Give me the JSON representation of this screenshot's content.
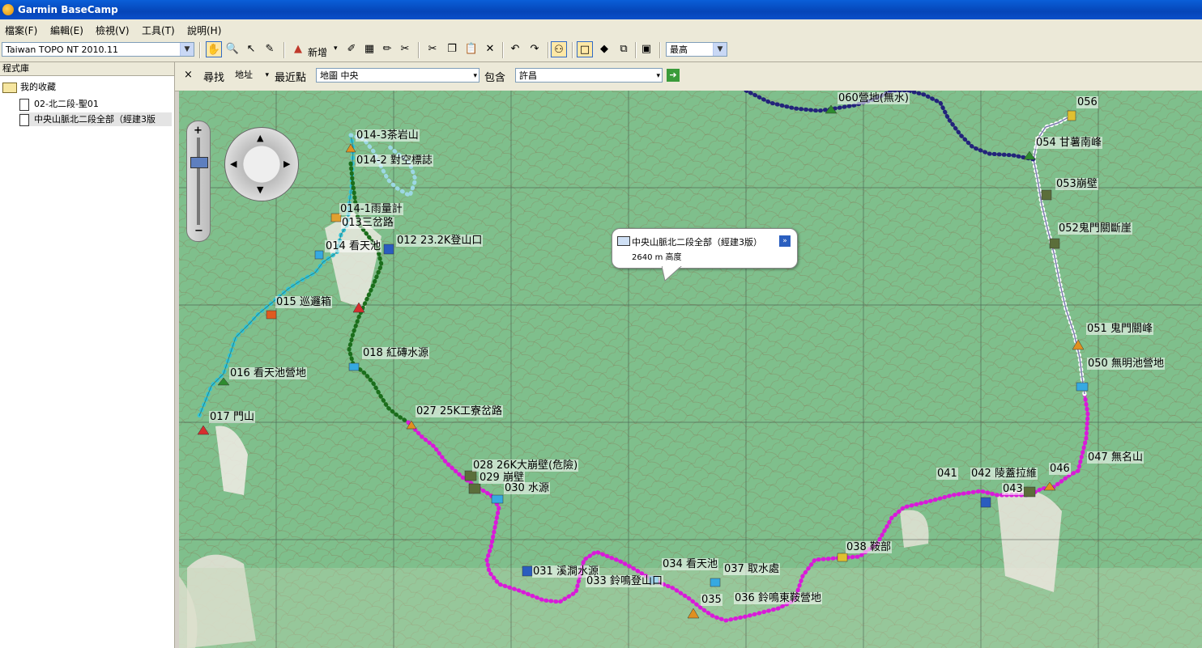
{
  "window": {
    "title": "Garmin BaseCamp"
  },
  "menu": [
    "檔案(F)",
    "編輯(E)",
    "檢視(V)",
    "工具(T)",
    "說明(H)"
  ],
  "toolbar": {
    "map_product": "Taiwan TOPO NT 2010.11",
    "new_label": "新增",
    "detail_level": "最高"
  },
  "library": {
    "header": "程式庫",
    "folder": "我的收藏",
    "items": [
      "02-北二段-聖01",
      "中央山脈北二段全部（經建3版"
    ]
  },
  "find": {
    "close": "×",
    "label": "尋找",
    "type": "地址",
    "nearest": "最近點",
    "map_field": "地圖 中央",
    "contains_label": "包含",
    "contains_field": "許昌"
  },
  "popup": {
    "name": "中央山脈北二段全部（經建3版）",
    "elevation": "2640 m 高度"
  },
  "waypoints": [
    "014-3茶岩山",
    "014-2 對空標誌",
    "014-1雨量計",
    "013三岔路",
    "014 看天池",
    "012 23.2K登山口",
    "015 巡邏箱",
    "018 紅磚水源",
    "016 看天池營地",
    "017 門山",
    "027 25K工寮岔路",
    "028 26K大崩壁(危險)",
    "029 崩壁",
    "030 水源",
    "031 溪澗水源",
    "033 鈴鳴登山口",
    "034 看天池",
    "037 取水處",
    "035",
    "036 鈴鳴東鞍營地",
    "038 鞍部",
    "041",
    "042 陵蓋拉維",
    "043",
    "046",
    "047 無名山",
    "050 無明池營地",
    "051 鬼門關峰",
    "052鬼門關斷崖",
    "053崩壁",
    "054 甘薯南峰",
    "056",
    "060營地(無水)"
  ],
  "colors": {
    "window_title": "#0a4fc9",
    "map_green": "#7fbf8c",
    "track_cyan": "#35c5d6",
    "track_green": "#1b6e1b",
    "track_magenta": "#d91ad9",
    "track_navy": "#23237a"
  }
}
